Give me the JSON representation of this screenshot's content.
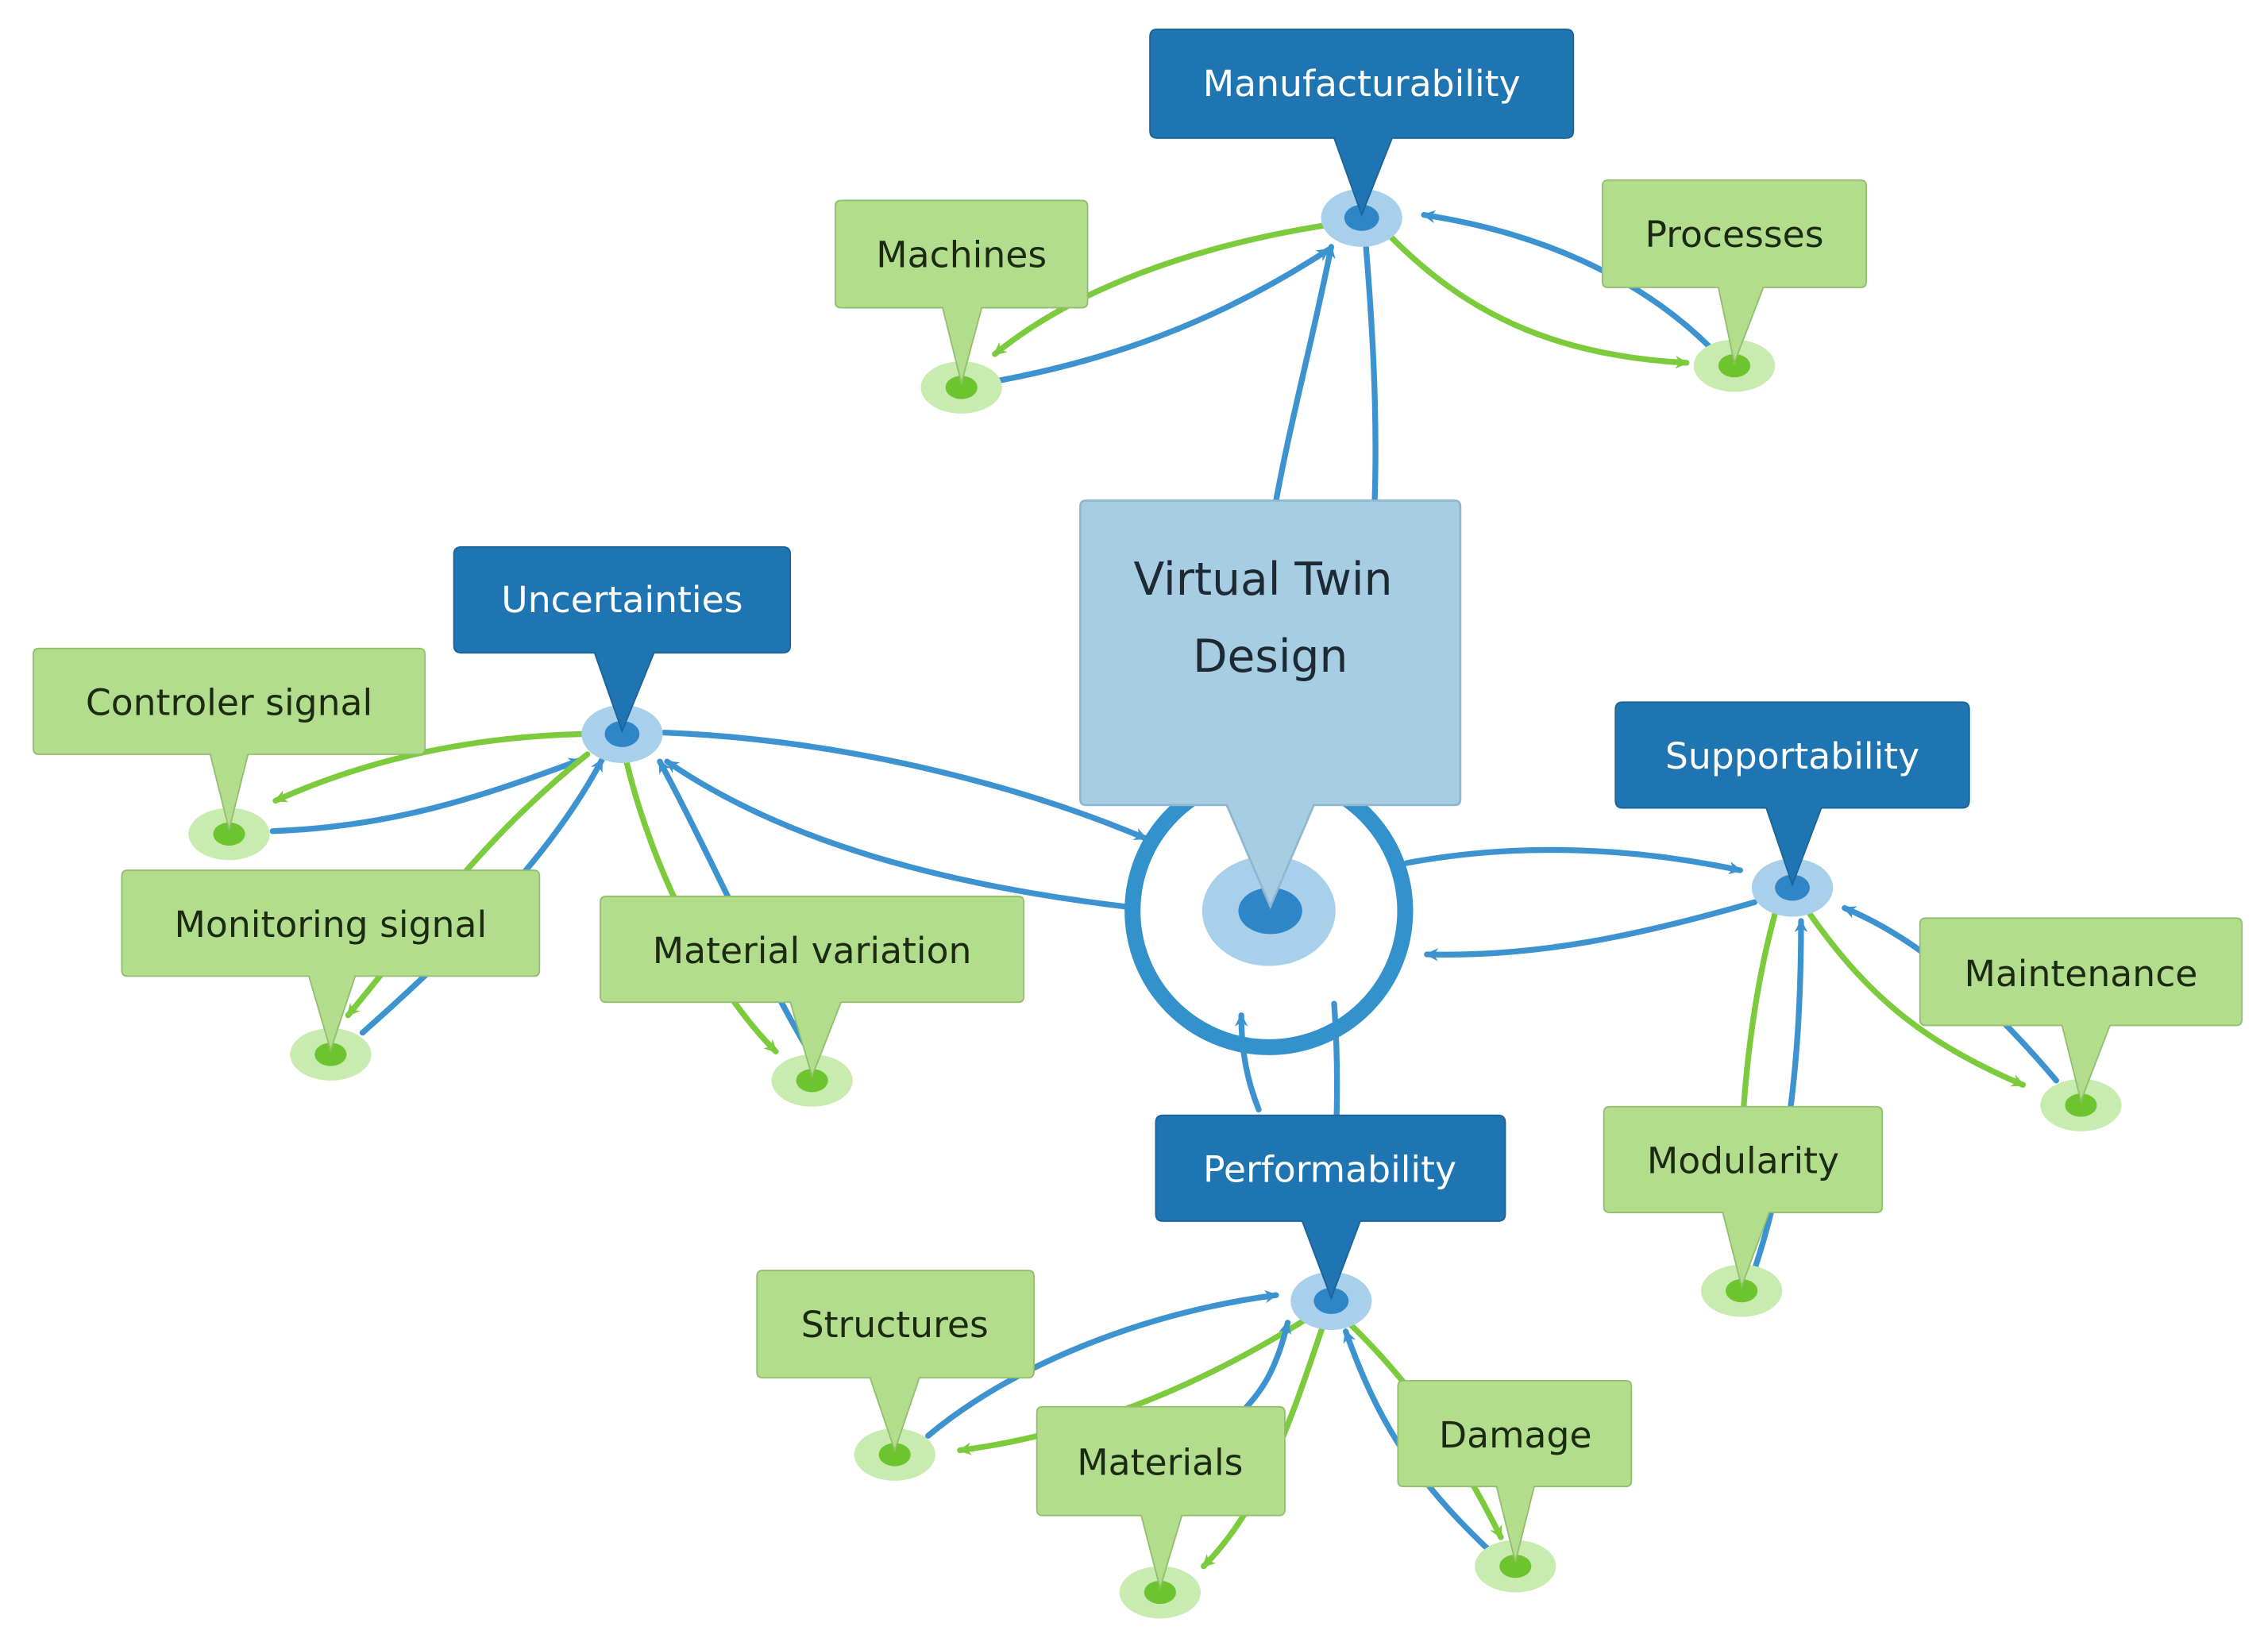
{
  "colors": {
    "category_fill": "#1f75b1",
    "category_stroke": "#1a6498",
    "leaf_fill": "#b1dd8c",
    "leaf_stroke": "#92bf6e",
    "center_fill": "#a7cde3",
    "center_stroke": "#8fb8d0",
    "blue_edge": "#3d93d0",
    "green_edge": "#7ccb3d",
    "blue_node_halo": "#a8d0ea",
    "blue_node_dot": "#2e86c6",
    "green_node_halo": "#c8ebaf",
    "green_node_dot": "#6cc42e",
    "ring": "#3391cc"
  },
  "center": {
    "title_line1": "Virtual Twin",
    "title_line2": "Design"
  },
  "categories": [
    {
      "id": "manufacturability",
      "label": "Manufacturability"
    },
    {
      "id": "uncertainties",
      "label": "Uncertainties"
    },
    {
      "id": "supportability",
      "label": "Supportability"
    },
    {
      "id": "performability",
      "label": "Performability"
    }
  ],
  "leaves": [
    {
      "id": "machines",
      "label": "Machines",
      "category": "manufacturability"
    },
    {
      "id": "processes",
      "label": "Processes",
      "category": "manufacturability"
    },
    {
      "id": "controler-signal",
      "label": "Controler signal",
      "category": "uncertainties"
    },
    {
      "id": "monitoring-signal",
      "label": "Monitoring signal",
      "category": "uncertainties"
    },
    {
      "id": "material-variation",
      "label": "Material variation",
      "category": "uncertainties"
    },
    {
      "id": "maintenance",
      "label": "Maintenance",
      "category": "supportability"
    },
    {
      "id": "modularity",
      "label": "Modularity",
      "category": "supportability"
    },
    {
      "id": "structures",
      "label": "Structures",
      "category": "performability"
    },
    {
      "id": "materials",
      "label": "Materials",
      "category": "performability"
    },
    {
      "id": "damage",
      "label": "Damage",
      "category": "performability"
    }
  ]
}
